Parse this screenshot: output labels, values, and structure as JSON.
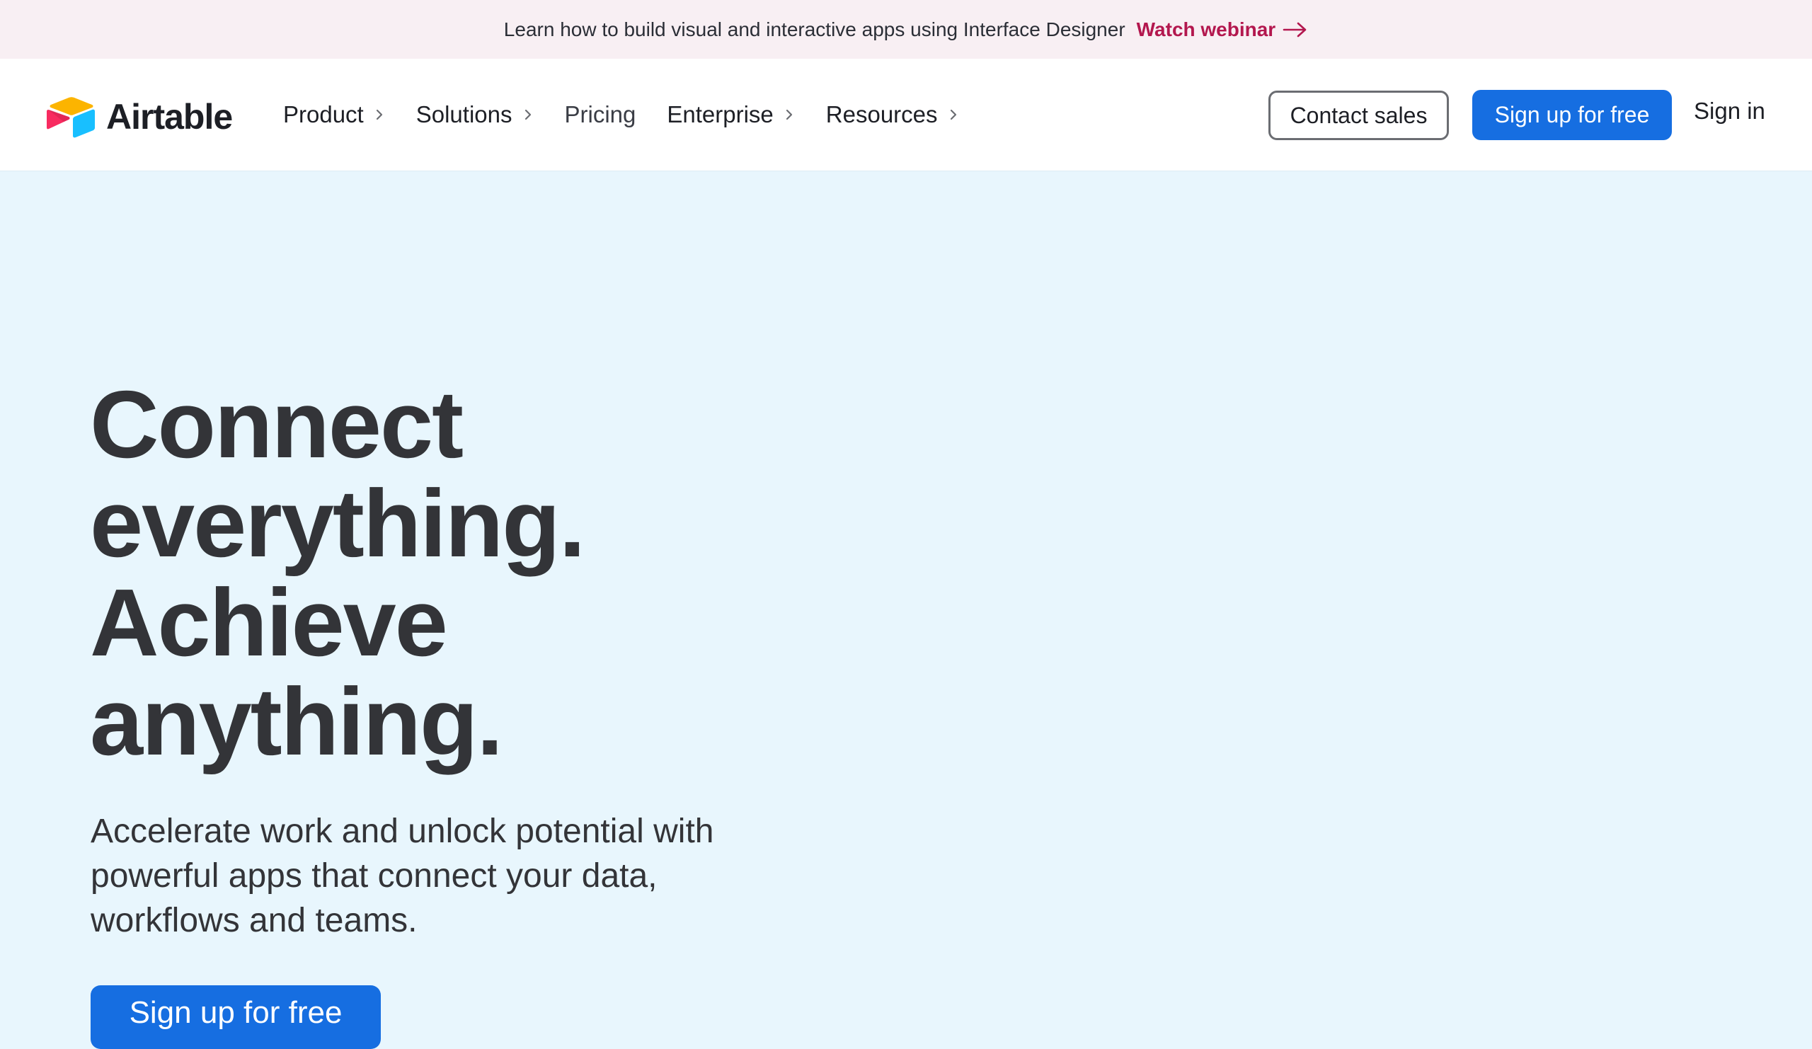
{
  "banner": {
    "text": "Learn how to build visual and interactive apps using Interface Designer",
    "cta_label": "Watch webinar",
    "cta_color": "#b3174e",
    "cta_icon": "arrow-right-icon"
  },
  "header": {
    "logo_text": "Airtable",
    "nav": [
      {
        "label": "Product",
        "has_submenu": true
      },
      {
        "label": "Solutions",
        "has_submenu": true
      },
      {
        "label": "Pricing",
        "has_submenu": false
      },
      {
        "label": "Enterprise",
        "has_submenu": true
      },
      {
        "label": "Resources",
        "has_submenu": true
      }
    ],
    "contact_sales_label": "Contact sales",
    "signup_label": "Sign up for free",
    "signin_label": "Sign in",
    "primary_color": "#166ee1"
  },
  "hero": {
    "title_lines": [
      "Connect",
      "everything.",
      "Achieve",
      "anything."
    ],
    "subtitle": "Accelerate work and unlock potential with powerful apps that connect your data, workflows and teams.",
    "cta_label": "Sign up for free",
    "background_color": "#e8f6fd"
  }
}
